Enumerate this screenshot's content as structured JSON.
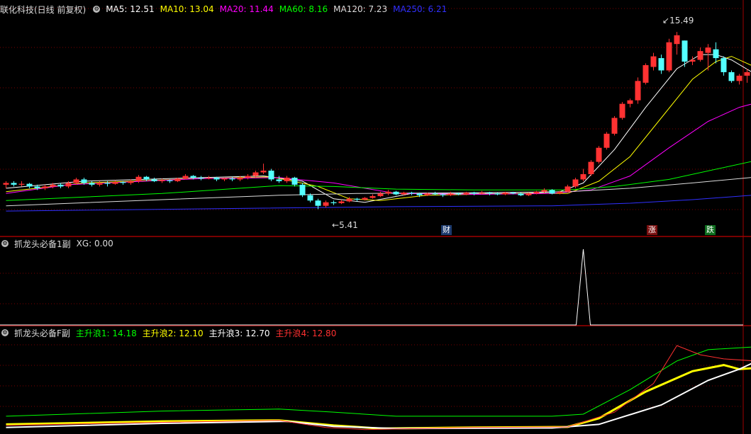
{
  "main": {
    "title": "联化科技(日线 前复权)",
    "ma": [
      {
        "label": "MA5: 12.51",
        "color": "#ffffff"
      },
      {
        "label": "MA10: 13.04",
        "color": "#ffff00"
      },
      {
        "label": "MA20: 11.44",
        "color": "#ff00ff"
      },
      {
        "label": "MA60: 8.16",
        "color": "#00ff00"
      },
      {
        "label": "MA120: 7.23",
        "color": "#dddddd"
      },
      {
        "label": "MA250: 6.21",
        "color": "#3030ff"
      }
    ],
    "high_label": "15.49",
    "low_label": "5.41",
    "tag_cai": "财",
    "tag_zhang": "涨",
    "tag_die": "跌"
  },
  "sub1": {
    "title": "抓龙头必备1副",
    "value": "XG: 0.00"
  },
  "sub2": {
    "title": "抓龙头必备F副",
    "items": [
      {
        "label": "主升浪1: 14.18",
        "color": "#00ff00"
      },
      {
        "label": "主升浪2: 12.10",
        "color": "#ffff00"
      },
      {
        "label": "主升浪3: 12.70",
        "color": "#ffffff"
      },
      {
        "label": "主升浪4: 12.80",
        "color": "#ff3030"
      }
    ]
  },
  "colors": {
    "up": "#ff3232",
    "down": "#54ffff",
    "grid": "#7a0000",
    "divider": "#a00000"
  },
  "chart_data": {
    "type": "candlestick",
    "price_range": [
      4.5,
      16.5
    ],
    "candles": [
      [
        6.8,
        6.9,
        6.6,
        7.0
      ],
      [
        6.9,
        6.8,
        6.7,
        7.0
      ],
      [
        6.8,
        6.85,
        6.7,
        7.0
      ],
      [
        6.85,
        6.7,
        6.6,
        6.9
      ],
      [
        6.7,
        6.6,
        6.5,
        6.8
      ],
      [
        6.6,
        6.7,
        6.5,
        6.8
      ],
      [
        6.7,
        6.8,
        6.6,
        6.9
      ],
      [
        6.8,
        6.7,
        6.6,
        6.9
      ],
      [
        6.7,
        6.9,
        6.6,
        7.0
      ],
      [
        6.9,
        7.1,
        6.8,
        7.2
      ],
      [
        7.1,
        6.9,
        6.8,
        7.2
      ],
      [
        6.9,
        6.8,
        6.7,
        7.0
      ],
      [
        6.8,
        6.9,
        6.7,
        7.0
      ],
      [
        6.9,
        6.85,
        6.7,
        7.0
      ],
      [
        6.85,
        6.95,
        6.8,
        7.05
      ],
      [
        6.95,
        6.9,
        6.8,
        7.0
      ],
      [
        6.9,
        7.0,
        6.8,
        7.1
      ],
      [
        7.0,
        7.25,
        6.9,
        7.35
      ],
      [
        7.25,
        7.1,
        7.0,
        7.3
      ],
      [
        7.1,
        7.0,
        6.95,
        7.2
      ],
      [
        7.0,
        7.05,
        6.9,
        7.15
      ],
      [
        7.05,
        7.0,
        6.9,
        7.1
      ],
      [
        7.0,
        7.15,
        6.95,
        7.2
      ],
      [
        7.15,
        7.3,
        7.1,
        7.4
      ],
      [
        7.3,
        7.2,
        7.1,
        7.35
      ],
      [
        7.2,
        7.15,
        7.05,
        7.3
      ],
      [
        7.15,
        7.2,
        7.1,
        7.3
      ],
      [
        7.2,
        7.1,
        7.0,
        7.25
      ],
      [
        7.1,
        7.15,
        7.0,
        7.2
      ],
      [
        7.15,
        7.1,
        7.0,
        7.25
      ],
      [
        7.1,
        7.2,
        7.0,
        7.3
      ],
      [
        7.2,
        7.3,
        7.1,
        7.4
      ],
      [
        7.3,
        7.5,
        7.2,
        7.6
      ],
      [
        7.5,
        7.6,
        7.4,
        8.0
      ],
      [
        7.6,
        7.1,
        7.0,
        7.7
      ],
      [
        7.1,
        7.0,
        6.9,
        7.3
      ],
      [
        7.0,
        7.2,
        6.9,
        7.3
      ],
      [
        7.2,
        6.8,
        6.7,
        7.25
      ],
      [
        6.8,
        6.2,
        6.1,
        6.9
      ],
      [
        6.2,
        5.9,
        5.8,
        6.3
      ],
      [
        5.9,
        5.6,
        5.41,
        6.0
      ],
      [
        5.6,
        5.8,
        5.5,
        5.9
      ],
      [
        5.8,
        5.75,
        5.65,
        5.9
      ],
      [
        5.75,
        5.85,
        5.7,
        5.95
      ],
      [
        5.85,
        6.0,
        5.8,
        6.1
      ],
      [
        6.0,
        5.95,
        5.85,
        6.05
      ],
      [
        5.95,
        6.05,
        5.9,
        6.1
      ],
      [
        6.05,
        6.15,
        6.0,
        6.25
      ],
      [
        6.15,
        6.3,
        6.1,
        6.4
      ],
      [
        6.3,
        6.4,
        6.2,
        6.5
      ],
      [
        6.4,
        6.25,
        6.2,
        6.45
      ],
      [
        6.25,
        6.35,
        6.2,
        6.4
      ],
      [
        6.35,
        6.3,
        6.2,
        6.4
      ],
      [
        6.3,
        6.2,
        6.1,
        6.35
      ],
      [
        6.2,
        6.3,
        6.15,
        6.35
      ],
      [
        6.3,
        6.25,
        6.2,
        6.4
      ],
      [
        6.25,
        6.2,
        6.1,
        6.3
      ],
      [
        6.2,
        6.3,
        6.15,
        6.4
      ],
      [
        6.3,
        6.25,
        6.2,
        6.35
      ],
      [
        6.25,
        6.35,
        6.2,
        6.4
      ],
      [
        6.35,
        6.3,
        6.2,
        6.4
      ],
      [
        6.3,
        6.35,
        6.25,
        6.45
      ],
      [
        6.35,
        6.3,
        6.2,
        6.4
      ],
      [
        6.3,
        6.25,
        6.2,
        6.35
      ],
      [
        6.25,
        6.35,
        6.2,
        6.4
      ],
      [
        6.35,
        6.3,
        6.25,
        6.4
      ],
      [
        6.3,
        6.2,
        6.15,
        6.35
      ],
      [
        6.2,
        6.3,
        6.15,
        6.35
      ],
      [
        6.3,
        6.4,
        6.25,
        6.45
      ],
      [
        6.4,
        6.5,
        6.3,
        6.6
      ],
      [
        6.5,
        6.3,
        6.25,
        6.55
      ],
      [
        6.3,
        6.4,
        6.25,
        6.45
      ],
      [
        6.4,
        6.7,
        6.35,
        6.8
      ],
      [
        6.7,
        7.1,
        6.6,
        7.2
      ],
      [
        7.1,
        7.4,
        7.0,
        7.7
      ],
      [
        7.4,
        8.1,
        7.3,
        8.2
      ],
      [
        8.1,
        8.9,
        8.0,
        9.0
      ],
      [
        8.9,
        9.7,
        8.8,
        9.8
      ],
      [
        9.7,
        10.6,
        9.6,
        10.7
      ],
      [
        10.6,
        11.4,
        10.5,
        11.5
      ],
      [
        11.4,
        11.6,
        11.2,
        11.7
      ],
      [
        11.6,
        12.7,
        11.4,
        12.9
      ],
      [
        12.6,
        13.6,
        12.5,
        13.7
      ],
      [
        13.5,
        14.1,
        13.3,
        14.3
      ],
      [
        14.0,
        13.3,
        13.1,
        14.2
      ],
      [
        13.3,
        14.9,
        13.2,
        15.1
      ],
      [
        14.8,
        15.3,
        14.2,
        15.49
      ],
      [
        15.0,
        13.8,
        13.5,
        15.0
      ],
      [
        13.8,
        13.9,
        13.6,
        14.1
      ],
      [
        13.9,
        14.4,
        13.8,
        14.6
      ],
      [
        14.3,
        14.6,
        13.3,
        14.8
      ],
      [
        14.5,
        14.0,
        13.7,
        14.9
      ],
      [
        14.0,
        13.2,
        13.0,
        14.1
      ],
      [
        13.2,
        12.7,
        12.6,
        13.3
      ],
      [
        12.7,
        13.0,
        12.5,
        13.1
      ],
      [
        13.0,
        13.2,
        12.6,
        13.4
      ],
      [
        13.2,
        14.3,
        12.9,
        14.4
      ]
    ],
    "ma_series": [
      {
        "name": "MA5",
        "color": "#ffffff",
        "points": [
          [
            0,
            6.6
          ],
          [
            10,
            7.0
          ],
          [
            25,
            7.2
          ],
          [
            33,
            7.3
          ],
          [
            38,
            7.0
          ],
          [
            42,
            6.0
          ],
          [
            46,
            5.8
          ],
          [
            52,
            6.3
          ],
          [
            60,
            6.3
          ],
          [
            66,
            6.3
          ],
          [
            71,
            6.4
          ],
          [
            74,
            6.9
          ],
          [
            78,
            8.8
          ],
          [
            82,
            11.2
          ],
          [
            86,
            13.4
          ],
          [
            89,
            14.2
          ],
          [
            91,
            14.2
          ],
          [
            93,
            13.9
          ],
          [
            96,
            13.1
          ]
        ]
      },
      {
        "name": "MA10",
        "color": "#ffff00",
        "points": [
          [
            0,
            6.4
          ],
          [
            10,
            6.9
          ],
          [
            25,
            7.15
          ],
          [
            34,
            7.25
          ],
          [
            40,
            6.7
          ],
          [
            44,
            6.0
          ],
          [
            48,
            5.9
          ],
          [
            54,
            6.2
          ],
          [
            66,
            6.3
          ],
          [
            72,
            6.3
          ],
          [
            76,
            7.0
          ],
          [
            80,
            8.4
          ],
          [
            84,
            10.6
          ],
          [
            88,
            12.8
          ],
          [
            91,
            13.8
          ],
          [
            93,
            14.1
          ],
          [
            96,
            13.5
          ]
        ]
      },
      {
        "name": "MA20",
        "color": "#ff00ff",
        "points": [
          [
            0,
            6.3
          ],
          [
            8,
            6.8
          ],
          [
            25,
            7.15
          ],
          [
            35,
            7.2
          ],
          [
            42,
            6.9
          ],
          [
            50,
            6.3
          ],
          [
            60,
            6.25
          ],
          [
            70,
            6.3
          ],
          [
            75,
            6.5
          ],
          [
            80,
            7.3
          ],
          [
            85,
            8.9
          ],
          [
            90,
            10.4
          ],
          [
            94,
            11.2
          ],
          [
            96,
            11.44
          ]
        ]
      },
      {
        "name": "MA60",
        "color": "#00ff00",
        "points": [
          [
            0,
            5.9
          ],
          [
            20,
            6.3
          ],
          [
            35,
            6.75
          ],
          [
            42,
            6.7
          ],
          [
            50,
            6.55
          ],
          [
            60,
            6.5
          ],
          [
            72,
            6.5
          ],
          [
            78,
            6.7
          ],
          [
            85,
            7.1
          ],
          [
            96,
            8.16
          ]
        ]
      },
      {
        "name": "MA120",
        "color": "#dddddd",
        "points": [
          [
            0,
            5.6
          ],
          [
            20,
            5.95
          ],
          [
            35,
            6.2
          ],
          [
            45,
            6.3
          ],
          [
            60,
            6.35
          ],
          [
            72,
            6.4
          ],
          [
            80,
            6.6
          ],
          [
            88,
            6.9
          ],
          [
            96,
            7.23
          ]
        ]
      },
      {
        "name": "MA250",
        "color": "#3030ff",
        "points": [
          [
            0,
            5.3
          ],
          [
            30,
            5.45
          ],
          [
            50,
            5.55
          ],
          [
            70,
            5.6
          ],
          [
            80,
            5.75
          ],
          [
            88,
            5.95
          ],
          [
            96,
            6.21
          ]
        ]
      }
    ],
    "xg_spike_index": 74,
    "sub2_series": [
      {
        "name": "主升浪1",
        "color": "#00ff00",
        "points": [
          [
            0,
            7.4
          ],
          [
            20,
            7.9
          ],
          [
            35,
            8.1
          ],
          [
            42,
            7.8
          ],
          [
            50,
            7.4
          ],
          [
            70,
            7.4
          ],
          [
            74,
            7.6
          ],
          [
            80,
            10.0
          ],
          [
            86,
            12.8
          ],
          [
            90,
            13.9
          ],
          [
            96,
            14.18
          ]
        ]
      },
      {
        "name": "主升浪2",
        "color": "#ffff00",
        "points": [
          [
            0,
            6.6
          ],
          [
            20,
            6.9
          ],
          [
            35,
            7.0
          ],
          [
            42,
            6.5
          ],
          [
            48,
            6.2
          ],
          [
            60,
            6.3
          ],
          [
            72,
            6.35
          ],
          [
            76,
            7.2
          ],
          [
            82,
            9.8
          ],
          [
            88,
            11.8
          ],
          [
            92,
            12.4
          ],
          [
            94,
            12.0
          ],
          [
            96,
            12.1
          ]
        ]
      },
      {
        "name": "主升浪3",
        "color": "#ffffff",
        "points": [
          [
            0,
            6.3
          ],
          [
            20,
            6.7
          ],
          [
            36,
            6.9
          ],
          [
            42,
            6.4
          ],
          [
            50,
            6.2
          ],
          [
            70,
            6.25
          ],
          [
            76,
            6.6
          ],
          [
            84,
            8.5
          ],
          [
            90,
            10.9
          ],
          [
            94,
            12.0
          ],
          [
            96,
            12.7
          ]
        ]
      },
      {
        "name": "主升浪4",
        "color": "#ff3030",
        "points": [
          [
            0,
            6.5
          ],
          [
            20,
            6.8
          ],
          [
            35,
            7.0
          ],
          [
            41,
            6.3
          ],
          [
            46,
            6.1
          ],
          [
            60,
            6.3
          ],
          [
            72,
            6.35
          ],
          [
            78,
            7.8
          ],
          [
            83,
            10.6
          ],
          [
            86,
            14.3
          ],
          [
            89,
            13.4
          ],
          [
            92,
            13.0
          ],
          [
            96,
            12.8
          ]
        ]
      }
    ],
    "sub2_range": [
      5.8,
      15.0
    ]
  }
}
